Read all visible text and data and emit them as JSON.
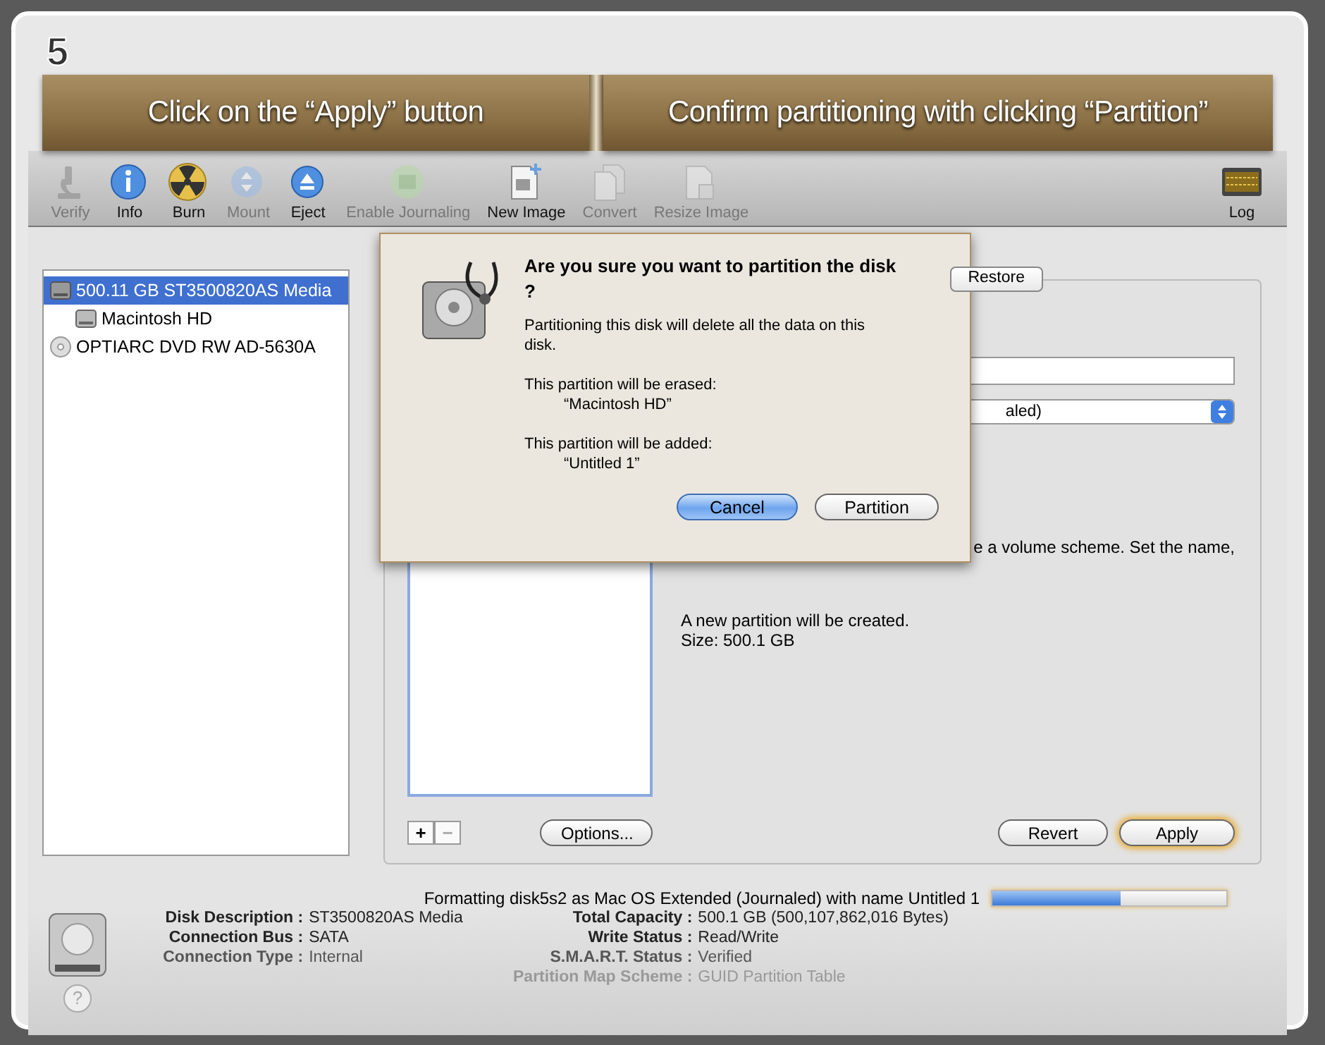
{
  "step": "5",
  "banner": [
    {
      "text": "Click on the “Apply” button"
    },
    {
      "text": "Confirm partitioning with clicking “Partition”"
    }
  ],
  "toolbar": [
    {
      "label": "Verify",
      "disabled": true
    },
    {
      "label": "Info",
      "disabled": false
    },
    {
      "label": "Burn",
      "disabled": false
    },
    {
      "label": "Mount",
      "disabled": true
    },
    {
      "label": "Eject",
      "disabled": false
    },
    {
      "label": "Enable Journaling",
      "disabled": true
    },
    {
      "label": "New Image",
      "disabled": false
    },
    {
      "label": "Convert",
      "disabled": true
    },
    {
      "label": "Resize Image",
      "disabled": true
    },
    {
      "label": "Log",
      "disabled": false
    }
  ],
  "sidebar": {
    "items": [
      {
        "label": "500.11 GB ST3500820AS Media",
        "kind": "disk",
        "selected": true,
        "children": [
          {
            "label": "Macintosh HD",
            "kind": "volume",
            "selected": false
          }
        ]
      },
      {
        "label": "OPTIARC DVD RW AD-5630A",
        "kind": "optical",
        "selected": false
      }
    ]
  },
  "tabs": [
    {
      "label": "Restore",
      "selected": false
    }
  ],
  "volume_info": {
    "format_fragment": "aled)",
    "description_fragment": [
      "e a volume scheme. Set the name,"
    ],
    "created": [
      "A new partition will be created.",
      "Size: 500.1 GB"
    ]
  },
  "list_buttons": [
    "+",
    "−"
  ],
  "options_button": "Options...",
  "action_buttons": [
    {
      "label": "Revert",
      "default": false
    },
    {
      "label": "Apply",
      "default": true
    }
  ],
  "status": {
    "text": "Formatting disk5s2 as Mac OS Extended (Journaled) with name Untitled 1",
    "level": 0.55
  },
  "info": [
    {
      "label": "Disk Description :",
      "value": "ST3500820AS Media",
      "dim": false
    },
    {
      "label": "Connection Bus :",
      "value": "SATA",
      "dim": false
    },
    {
      "label": "Connection Type :",
      "value": "Internal",
      "dim": false
    }
  ],
  "info_right": [
    {
      "label": "Total Capacity :",
      "value": "500.1 GB (500,107,862,016 Bytes)",
      "dim": false
    },
    {
      "label": "Write Status :",
      "value": "Read/Write",
      "dim": false
    },
    {
      "label": "S.M.A.R.T. Status :",
      "value": "Verified",
      "dim": false
    },
    {
      "label": "Partition Map Scheme :",
      "value": "GUID Partition Table",
      "dim": true
    }
  ],
  "help": "?",
  "dialog": {
    "title": "Are you sure you want to partition the disk ?",
    "message": "Partitioning this disk will delete all the data on this disk.",
    "erased_label": "This partition will be erased:",
    "erased_name": "“Macintosh HD”",
    "added_label": "This partition will be added:",
    "added_name": "“Untitled 1”",
    "buttons": [
      {
        "label": "Cancel",
        "default": true
      },
      {
        "label": "Partition",
        "default": false
      }
    ]
  }
}
